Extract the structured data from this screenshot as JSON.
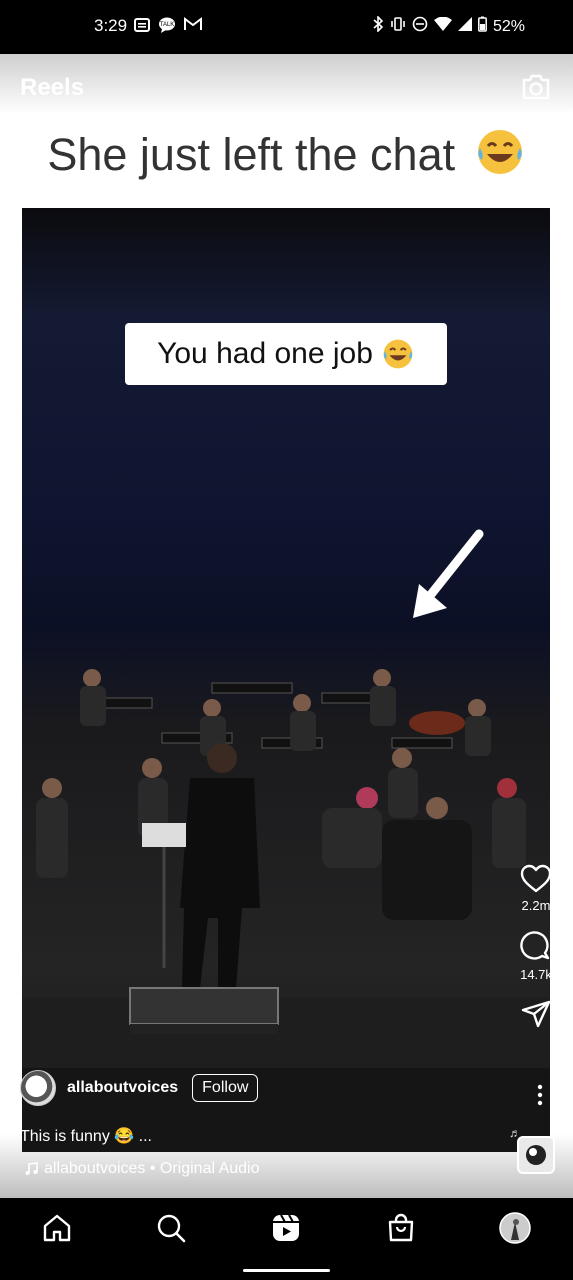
{
  "status_bar": {
    "time": "3:29",
    "battery": "52%",
    "left_icons": [
      "message-icon",
      "talk-icon",
      "gmail-icon"
    ],
    "right_icons": [
      "bluetooth-icon",
      "vibrate-icon",
      "dnd-icon",
      "wifi-icon",
      "signal-icon",
      "battery-icon"
    ]
  },
  "header": {
    "title": "Reels",
    "camera_icon": "camera-icon"
  },
  "reel": {
    "top_caption": "She just left the chat",
    "overlay_text": "You had one job",
    "likes": "2.2m",
    "comments": "14.7k"
  },
  "author": {
    "name": "allaboutvoices",
    "follow_label": "Follow"
  },
  "caption": "This is funny 😂 ...",
  "audio": {
    "label": "allaboutvoices • Original Audio"
  },
  "nav": [
    "home-icon",
    "search-icon",
    "reels-icon",
    "shop-icon",
    "profile-icon"
  ],
  "colors": {
    "background": "#000000",
    "text": "#ffffff"
  }
}
